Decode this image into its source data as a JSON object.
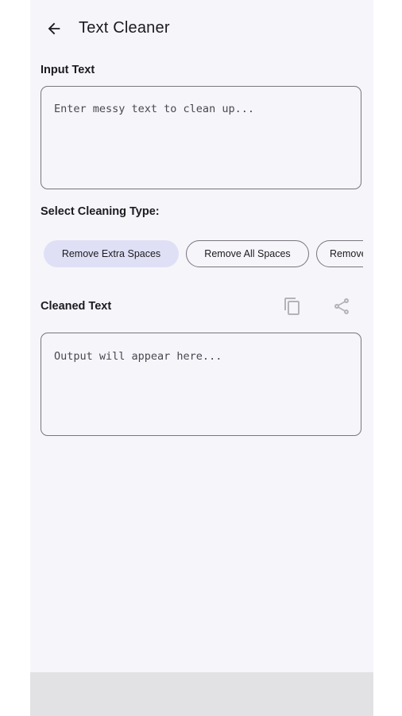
{
  "app_bar": {
    "title": "Text Cleaner",
    "back_icon": "arrow-back-icon"
  },
  "input_section": {
    "label": "Input Text",
    "placeholder": "Enter messy text to clean up...",
    "value": ""
  },
  "cleaning_section": {
    "label": "Select Cleaning Type:",
    "options": [
      {
        "label": "Remove Extra Spaces",
        "selected": true
      },
      {
        "label": "Remove All Spaces",
        "selected": false
      },
      {
        "label": "Remove",
        "selected": false
      }
    ]
  },
  "output_section": {
    "label": "Cleaned Text",
    "placeholder": "Output will appear here...",
    "copy_icon": "copy-icon",
    "share_icon": "share-icon"
  },
  "colors": {
    "background": "#f6f5fa",
    "chip_selected": "#dfe0f6",
    "outline": "#79767d",
    "bottom_bar": "#e2e2e5",
    "disabled_icon": "#b4b3b8"
  }
}
